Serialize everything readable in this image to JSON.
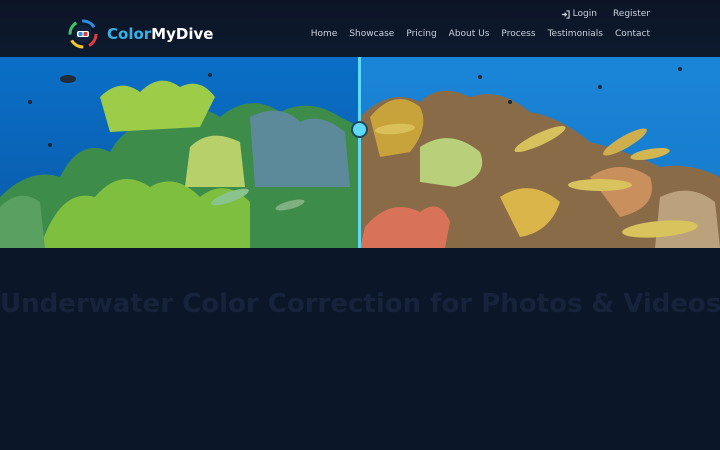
{
  "brand": {
    "name_part1": "Color",
    "name_part2": "MyDive",
    "logo_icon": "dive-mask-logo-icon"
  },
  "auth": {
    "login_label": "Login",
    "login_icon": "sign-in-icon",
    "register_label": "Register"
  },
  "nav": {
    "items": [
      {
        "label": "Home"
      },
      {
        "label": "Showcase"
      },
      {
        "label": "Pricing"
      },
      {
        "label": "About Us"
      },
      {
        "label": "Process"
      },
      {
        "label": "Testimonials"
      },
      {
        "label": "Contact"
      }
    ]
  },
  "hero": {
    "before_label": "",
    "after_label": "",
    "slider_position": 0.5
  },
  "headline": "Underwater Color Correction for Photos & Videos",
  "colors": {
    "background": "#0b1729",
    "accent": "#34b3e6",
    "slider": "#5fd9f5",
    "headline_faded": "#16233a"
  }
}
